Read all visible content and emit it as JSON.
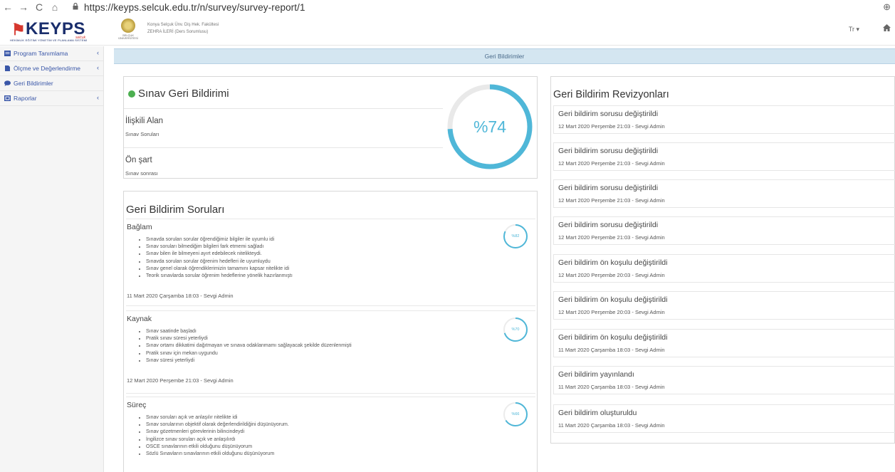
{
  "browser": {
    "url": "https://keyps.selcuk.edu.tr/n/survey/survey-report/1",
    "back": "←",
    "forward": "→",
    "reload": "C",
    "home": "⌂",
    "zoom": "⊕"
  },
  "header": {
    "logo": "KEYPS",
    "logo_sub": "HEKİMLİK EĞİTİMİ YÖNETİM VE PLANLAMA SİSTEMİ",
    "logo_tag": "selcuk",
    "uni_name": "SELÇUK ÜNİVERSİTESİ",
    "faculty": "Konya Selçuk Ünv. Diş Hek. Fakültesi",
    "user": "ZEHRA İLERİ (Ders Sorumlusu)",
    "language": "Tr ▾"
  },
  "sidebar": {
    "items": [
      {
        "label": "Program Tanımlama",
        "icon": "book-icon",
        "chevron": "‹"
      },
      {
        "label": "Ölçme ve Değerlendirme",
        "icon": "document-icon",
        "chevron": "‹"
      },
      {
        "label": "Geri Bildirimler",
        "icon": "chat-icon",
        "chevron": ""
      },
      {
        "label": "Raporlar",
        "icon": "report-icon",
        "chevron": "‹"
      }
    ]
  },
  "page_title": "Geri Bildirimler",
  "summary": {
    "title": "Sınav Geri Bildirimi",
    "area_label": "İlişkili Alan",
    "area_value": "Sınav Soruları",
    "prereq_label": "Ön şart",
    "prereq_value": "Sınav sonrası",
    "percent_label": "%74",
    "percent": 74
  },
  "questions": {
    "title": "Geri Bildirim Soruları",
    "sections": [
      {
        "heading": "Bağlam",
        "percent_label": "%82",
        "percent": 82,
        "items": [
          "Sınavda sorulan sorular öğrendiğimiz bilgiler ile uyumlu idi",
          "Sınav soruları bilmediğim bilgileri fark etmemi sağladı",
          "Sınav bilen ile bilmeyeni ayırt edebilecek nitelikteydi.",
          "Sınavda sorulan sorular öğrenim hedefleri ile uyumluydu",
          "Sınav genel olarak öğrendiklerimizin tamamını kapsar nitelikte idi",
          "Teorik sınavlarda sorular öğrenim hedeflerine yönelik hazırlanmıştı"
        ],
        "date": "11 Mart 2020 Çarşamba 18:03 - Sevgi Admin"
      },
      {
        "heading": "Kaynak",
        "percent_label": "%70",
        "percent": 70,
        "items": [
          "Sınav saatinde başladı",
          "Pratik sınav süresi yeterliydi",
          "Sınav ortamı dikkatimi dağıtmayan ve sınava odaklanmamı sağlayacak şekilde düzenlenmişti",
          "Pratik sınav için mekan uygundu",
          "Sınav süresi yeterliydi"
        ],
        "date": "12 Mart 2020 Perşembe 21:03 - Sevgi Admin"
      },
      {
        "heading": "Süreç",
        "percent_label": "%66",
        "percent": 66,
        "items": [
          "Sınav soruları açık ve anlaşılır nitelikte idi",
          "Sınav sorularının objektif olarak değerlendirildiğini düşünüyorum.",
          "Sınav gözetmenleri görevlerinin bilincindeydi",
          "İngilizce sınav soruları açık ve anlaşılırdı",
          "OSCE sınavlarının etkili olduğunu düşünüyorum",
          "Sözlü Sınavların sınavlarının etkili olduğunu düşünüyorum"
        ],
        "date": ""
      }
    ]
  },
  "revisions": {
    "title": "Geri Bildirim Revizyonları",
    "items": [
      {
        "name": "Geri bildirim sorusu değiştirildi",
        "date": "12 Mart 2020 Perşembe 21:03 - Sevgi Admin"
      },
      {
        "name": "Geri bildirim sorusu değiştirildi",
        "date": "12 Mart 2020 Perşembe 21:03 - Sevgi Admin"
      },
      {
        "name": "Geri bildirim sorusu değiştirildi",
        "date": "12 Mart 2020 Perşembe 21:03 - Sevgi Admin"
      },
      {
        "name": "Geri bildirim sorusu değiştirildi",
        "date": "12 Mart 2020 Perşembe 21:03 - Sevgi Admin"
      },
      {
        "name": "Geri bildirim ön koşulu değiştirildi",
        "date": "12 Mart 2020 Perşembe 20:03 - Sevgi Admin"
      },
      {
        "name": "Geri bildirim ön koşulu değiştirildi",
        "date": "12 Mart 2020 Perşembe 20:03 - Sevgi Admin"
      },
      {
        "name": "Geri bildirim ön koşulu değiştirildi",
        "date": "11 Mart 2020 Çarşamba 18:03 - Sevgi Admin"
      },
      {
        "name": "Geri bildirim yayınlandı",
        "date": "11 Mart 2020 Çarşamba 18:03 - Sevgi Admin"
      },
      {
        "name": "Geri bildirim oluşturuldu",
        "date": "11 Mart 2020 Çarşamba 18:03 - Sevgi Admin"
      }
    ]
  },
  "colors": {
    "accent": "#4fb7d8",
    "brand_blue": "#1a2e6c",
    "brand_red": "#d6372e",
    "title_bar": "#d4e6f1",
    "status_green": "#4caf50",
    "sidebar_link": "#3a57a8"
  }
}
